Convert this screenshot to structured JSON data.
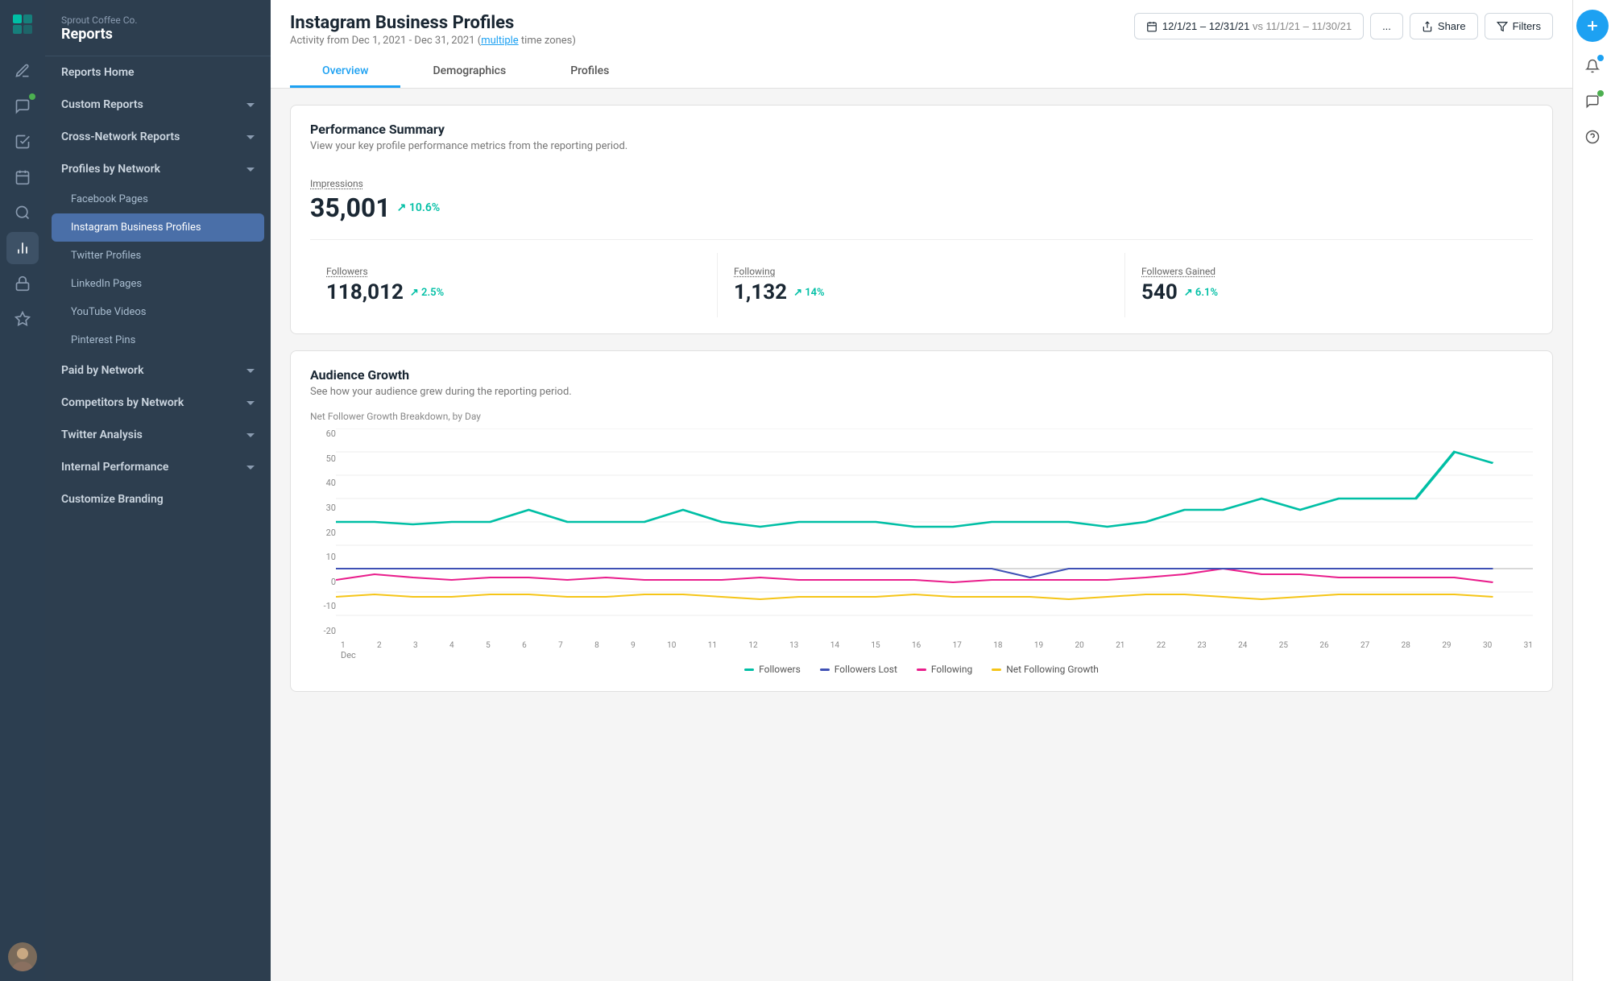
{
  "app": {
    "company": "Sprout Coffee Co.",
    "title": "Reports"
  },
  "header": {
    "page_title": "Instagram Business Profiles",
    "subtitle_pre": "Activity from Dec 1, 2021 - Dec 31, 2021 (",
    "subtitle_link": "multiple",
    "subtitle_post": " time zones)",
    "date_range": "12/1/21 – 12/31/21",
    "date_vs": "vs 11/1/21 – 11/30/21"
  },
  "tabs": [
    {
      "label": "Overview",
      "active": true
    },
    {
      "label": "Demographics",
      "active": false
    },
    {
      "label": "Profiles",
      "active": false
    }
  ],
  "performance_summary": {
    "title": "Performance Summary",
    "subtitle": "View your key profile performance metrics from the reporting period.",
    "impressions_label": "Impressions",
    "impressions_value": "35,001",
    "impressions_change": "10.6%",
    "followers_label": "Followers",
    "followers_value": "118,012",
    "followers_change": "2.5%",
    "following_label": "Following",
    "following_value": "1,132",
    "following_change": "14%",
    "followers_gained_label": "Followers Gained",
    "followers_gained_value": "540",
    "followers_gained_change": "6.1%"
  },
  "audience_growth": {
    "title": "Audience Growth",
    "subtitle": "See how your audience grew during the reporting period.",
    "chart_label": "Net Follower Growth Breakdown, by Day",
    "y_labels": [
      "60",
      "50",
      "40",
      "30",
      "20",
      "10",
      "0",
      "-10",
      "-20"
    ],
    "x_labels": [
      "1",
      "2",
      "3",
      "4",
      "5",
      "6",
      "7",
      "8",
      "9",
      "10",
      "11",
      "12",
      "13",
      "14",
      "15",
      "16",
      "17",
      "18",
      "19",
      "20",
      "21",
      "22",
      "23",
      "24",
      "25",
      "26",
      "27",
      "28",
      "29",
      "30",
      "31"
    ],
    "x_sub": "Dec",
    "legend": [
      {
        "label": "Followers",
        "color": "#00bfa5"
      },
      {
        "label": "Followers Lost",
        "color": "#3f51b5"
      },
      {
        "label": "Following",
        "color": "#e91e8c"
      },
      {
        "label": "Net Following Growth",
        "color": "#f5c518"
      }
    ]
  },
  "sidebar": {
    "nav_items": [
      {
        "label": "Reports Home",
        "expandable": false,
        "active": false
      },
      {
        "label": "Custom Reports",
        "expandable": true,
        "active": false
      },
      {
        "label": "Cross-Network Reports",
        "expandable": true,
        "active": false
      },
      {
        "label": "Profiles by Network",
        "expandable": true,
        "active": true
      }
    ],
    "profiles_sub": [
      {
        "label": "Facebook Pages"
      },
      {
        "label": "Instagram Business Profiles",
        "active": true
      },
      {
        "label": "Twitter Profiles"
      },
      {
        "label": "LinkedIn Pages"
      },
      {
        "label": "YouTube Videos"
      },
      {
        "label": "Pinterest Pins"
      }
    ],
    "bottom_items": [
      {
        "label": "Paid by Network",
        "expandable": true
      },
      {
        "label": "Competitors by Network",
        "expandable": true
      },
      {
        "label": "Twitter Analysis",
        "expandable": true
      },
      {
        "label": "Internal Performance",
        "expandable": true
      },
      {
        "label": "Customize Branding",
        "expandable": false
      }
    ]
  },
  "buttons": {
    "share": "Share",
    "filters": "Filters",
    "more": "..."
  }
}
